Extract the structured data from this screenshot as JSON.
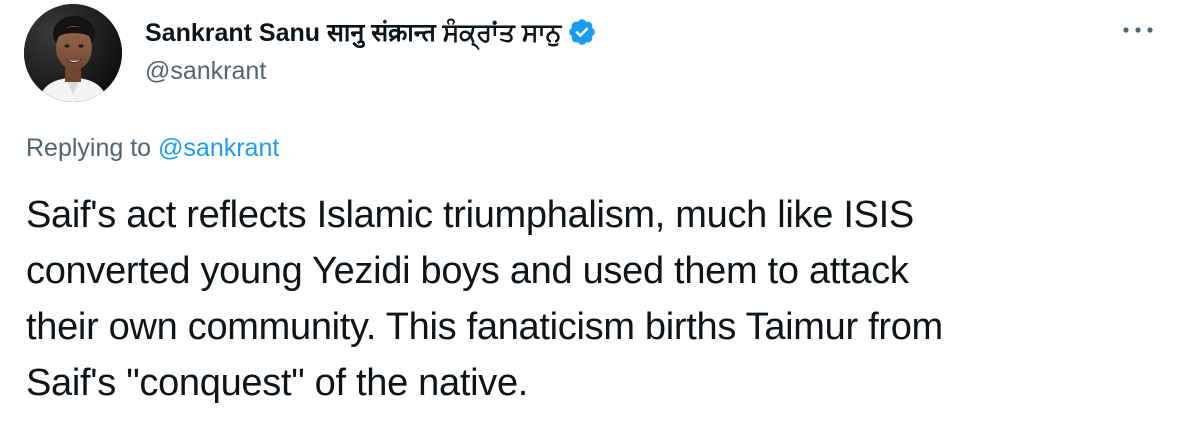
{
  "author": {
    "display_name": "Sankrant Sanu सानु संक्रान्त ਸੰਕ੍ਰਾਂਤ ਸਾਨੁ",
    "handle": "@sankrant",
    "verified": true,
    "avatar_icon": "profile-photo"
  },
  "reply": {
    "prefix": "Replying to ",
    "mention": "@sankrant"
  },
  "tweet": {
    "lines": [
      "Saif's act reflects Islamic triumphalism, much like ISIS",
      "converted young Yezidi boys and used them to attack",
      "their own community. This fanaticism births Taimur from",
      "Saif's \"conquest\" of the native."
    ]
  },
  "icons": {
    "verified": "verified-badge-icon",
    "more": "more-options-icon"
  },
  "colors": {
    "text_primary": "#0f1419",
    "text_secondary": "#536471",
    "accent": "#1d9bf0"
  }
}
